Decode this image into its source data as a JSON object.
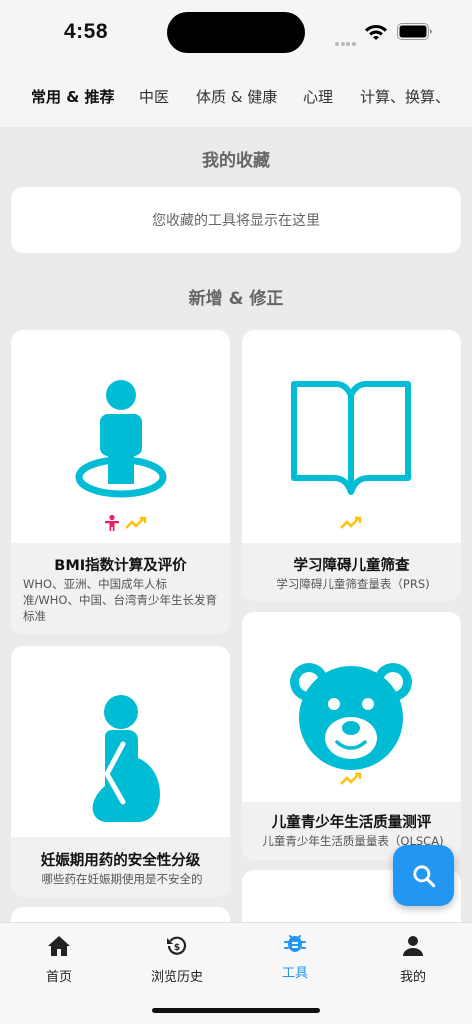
{
  "status": {
    "time": "4:58"
  },
  "tabs": [
    {
      "label": "常用 & 推荐",
      "active": true
    },
    {
      "label": "中医"
    },
    {
      "label": "体质 & 健康"
    },
    {
      "label": "心理"
    },
    {
      "label": "计算、换算、"
    }
  ],
  "favorites": {
    "title": "我的收藏",
    "empty_text": "您收藏的工具将显示在这里"
  },
  "new_section": {
    "title": "新增 & 修正"
  },
  "cards": [
    {
      "title": "BMI指数计算及评价",
      "desc": "WHO、亚洲、中国成年人标准/WHO、中国、台湾青少年生长发育标准",
      "icon": "person-on-spot-icon"
    },
    {
      "title": "学习障碍儿童筛查",
      "desc": "学习障碍儿童筛查量表（PRS)",
      "icon": "open-book-icon"
    },
    {
      "title": "妊娠期用药的安全性分级",
      "desc": "哪些药在妊娠期使用是不安全的",
      "icon": "pregnant-woman-icon"
    },
    {
      "title": "儿童青少年生活质量测评",
      "desc": "儿童青少年生活质量量表（QLSCA)",
      "icon": "teddy-bear-icon"
    }
  ],
  "bottom_nav": [
    {
      "label": "首页",
      "icon": "home-icon"
    },
    {
      "label": "浏览历史",
      "icon": "history-icon"
    },
    {
      "label": "工具",
      "icon": "bug-icon",
      "active": true
    },
    {
      "label": "我的",
      "icon": "person-icon"
    }
  ],
  "colors": {
    "accent": "#2196f3",
    "icon_teal": "#00bcd4",
    "badge_yellow": "#ffc107",
    "badge_pink": "#e91e63"
  }
}
